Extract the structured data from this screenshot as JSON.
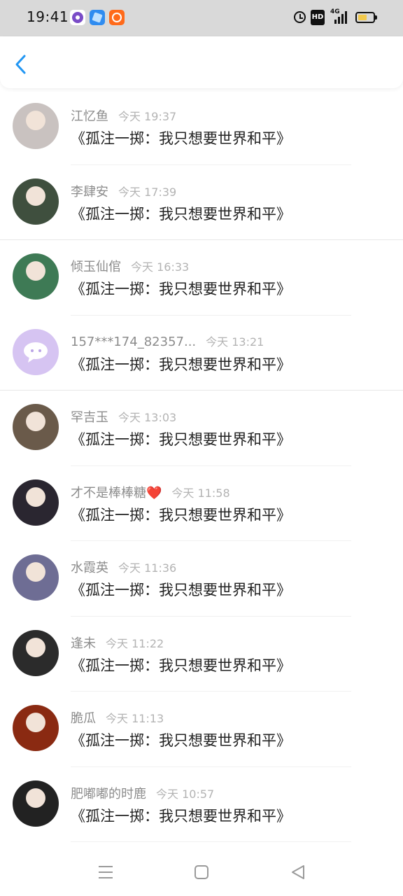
{
  "status_bar": {
    "time": "19:41",
    "hd_label": "HD",
    "network_label": "4G",
    "battery_level": 0.55
  },
  "header": {
    "back_icon": "chevron-left-icon",
    "accent_color": "#2196f3"
  },
  "comments": [
    {
      "name": "江忆鱼",
      "time": "今天 19:37",
      "text": "《孤注一掷：我只想要世界和平》",
      "avatar_color": "#c9c2c0"
    },
    {
      "name": "李肆安",
      "time": "今天 17:39",
      "text": "《孤注一掷：我只想要世界和平》",
      "avatar_color": "#3f4f3e"
    },
    {
      "name": "倾玉仙倌",
      "time": "今天 16:33",
      "text": "《孤注一掷：我只想要世界和平》",
      "avatar_color": "#3e7a55"
    },
    {
      "name": "157***174_82357...",
      "time": "今天 13:21",
      "text": "《孤注一掷：我只想要世界和平》",
      "avatar_color": "#d6c4f2"
    },
    {
      "name": "罕吉玉",
      "time": "今天 13:03",
      "text": "《孤注一掷：我只想要世界和平》",
      "avatar_color": "#6a5a4a"
    },
    {
      "name": "才不是棒棒糖❤️",
      "time": "今天 11:58",
      "text": "《孤注一掷：我只想要世界和平》",
      "avatar_color": "#2a2630"
    },
    {
      "name": "水霞英",
      "time": "今天 11:36",
      "text": "《孤注一掷：我只想要世界和平》",
      "avatar_color": "#6e6d94"
    },
    {
      "name": "逢未",
      "time": "今天 11:22",
      "text": "《孤注一掷：我只想要世界和平》",
      "avatar_color": "#2b2b2b"
    },
    {
      "name": "脆瓜",
      "time": "今天 11:13",
      "text": "《孤注一掷：我只想要世界和平》",
      "avatar_color": "#8a2a12"
    },
    {
      "name": "肥嘟嘟的时鹿",
      "time": "今天 10:57",
      "text": "《孤注一掷：我只想要世界和平》",
      "avatar_color": "#222222"
    }
  ],
  "nav_bar": {
    "menu_icon": "menu-icon",
    "home_icon": "home-square-icon",
    "back_icon": "back-triangle-icon"
  }
}
